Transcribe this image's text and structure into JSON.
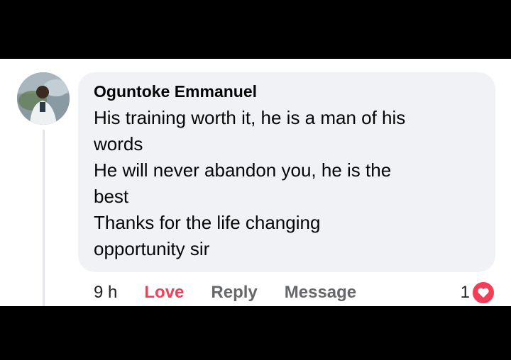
{
  "comment": {
    "author": "Oguntoke Emmanuel",
    "lines": [
      "His training worth it, he is a man of his",
      "words",
      "He will never abandon you, he is the",
      "best",
      "Thanks for the life changing",
      "opportunity sir"
    ]
  },
  "actions": {
    "time": "9 h",
    "love": "Love",
    "reply": "Reply",
    "message": "Message"
  },
  "reactions": {
    "count": "1",
    "icon": "heart-icon"
  },
  "colors": {
    "love": "#f33e58",
    "bubble": "#f0f2f5",
    "action_text": "#65676b"
  }
}
